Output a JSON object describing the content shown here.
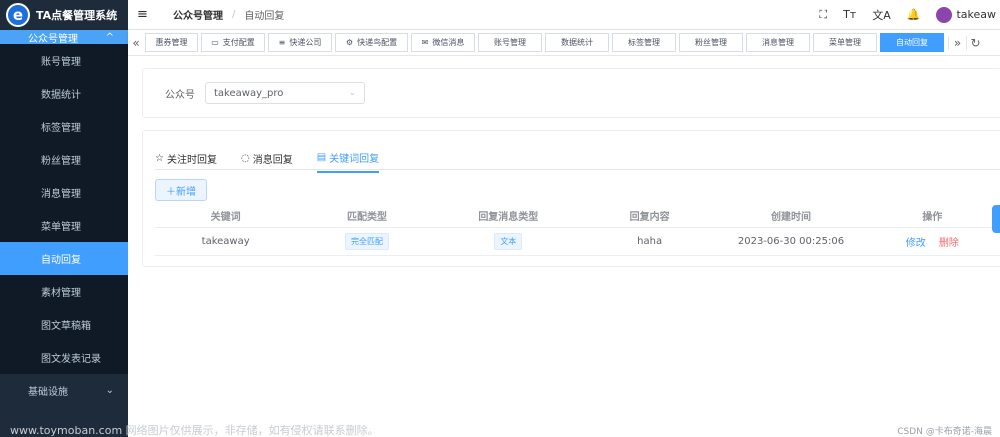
{
  "app": {
    "logo_letter": "e",
    "title": "TA点餐管理系统"
  },
  "sidebar": {
    "parent": {
      "label": "公众号管理",
      "chevron": "^"
    },
    "items": [
      {
        "label": "账号管理"
      },
      {
        "label": "数据统计"
      },
      {
        "label": "标签管理"
      },
      {
        "label": "粉丝管理"
      },
      {
        "label": "消息管理"
      },
      {
        "label": "菜单管理"
      },
      {
        "label": "自动回复"
      },
      {
        "label": "素材管理"
      },
      {
        "label": "图文草稿箱"
      },
      {
        "label": "图文发表记录"
      }
    ],
    "bottom": {
      "label": "基础设施",
      "chevron": "⌄"
    }
  },
  "topbar": {
    "menu_icon": "≡",
    "breadcrumb": [
      "公众号管理",
      "/",
      "自动回复"
    ],
    "icons": {
      "fullscreen": "⛶",
      "fontsize": "Tт",
      "translate": "文A",
      "bell": "🔔"
    },
    "user": "takeaw"
  },
  "tagsbar": {
    "left_arrow": "«",
    "tags": [
      {
        "icon": "",
        "label": "惠券管理"
      },
      {
        "icon": "▭",
        "label": "支付配置"
      },
      {
        "icon": "≡",
        "label": "快递公司"
      },
      {
        "icon": "⚙",
        "label": "快递鸟配置"
      },
      {
        "icon": "✉",
        "label": "微信消息"
      },
      {
        "icon": "",
        "label": "账号管理"
      },
      {
        "icon": "",
        "label": "数据统计"
      },
      {
        "icon": "",
        "label": "标签管理"
      },
      {
        "icon": "",
        "label": "粉丝管理"
      },
      {
        "icon": "",
        "label": "消息管理"
      },
      {
        "icon": "",
        "label": "菜单管理"
      },
      {
        "icon": "",
        "label": "自动回复"
      }
    ],
    "right_arrow": "»",
    "refresh": "↻"
  },
  "filter": {
    "label": "公众号",
    "value": "takeaway_pro",
    "chevron": "⌄"
  },
  "tabs": [
    {
      "icon": "☆",
      "label": "关注时回复"
    },
    {
      "icon": "◌",
      "label": "消息回复"
    },
    {
      "icon": "▤",
      "label": "关键词回复"
    }
  ],
  "add_button": "＋新增",
  "table": {
    "headers": [
      "关键词",
      "匹配类型",
      "回复消息类型",
      "回复内容",
      "创建时间",
      "操作"
    ],
    "rows": [
      {
        "keyword": "takeaway",
        "match": "完全匹配",
        "msg_type": "文本",
        "content": "haha",
        "created": "2023-06-30 00:25:06",
        "edit": "修改",
        "delete": "删除"
      }
    ]
  },
  "watermark": {
    "left": "www.toymoban.com 网络图片仅供展示，非存储，如有侵权请联系删除。",
    "right": "CSDN @卡布奇诺-海晨"
  }
}
